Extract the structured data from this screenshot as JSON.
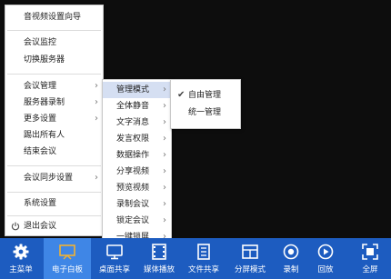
{
  "main_menu": {
    "items": [
      {
        "label": "音视频设置向导"
      },
      {
        "label": "会议监控"
      },
      {
        "label": "切换服务器"
      },
      {
        "label": "会议管理",
        "arrow": "›"
      },
      {
        "label": "服务器录制",
        "arrow": "›"
      },
      {
        "label": "更多设置",
        "arrow": "›"
      },
      {
        "label": "踢出所有人"
      },
      {
        "label": "结束会议"
      },
      {
        "label": "会议同步设置",
        "arrow": "›"
      },
      {
        "label": "系统设置"
      },
      {
        "label": "退出会议"
      }
    ]
  },
  "submenu_meeting": {
    "items": [
      {
        "label": "管理模式",
        "arrow": "›"
      },
      {
        "label": "全体静音",
        "arrow": "›"
      },
      {
        "label": "文字消息",
        "arrow": "›"
      },
      {
        "label": "发言权限",
        "arrow": "›"
      },
      {
        "label": "数据操作",
        "arrow": "›"
      },
      {
        "label": "分享视频",
        "arrow": "›"
      },
      {
        "label": "预览视频",
        "arrow": "›"
      },
      {
        "label": "录制会议",
        "arrow": "›"
      },
      {
        "label": "锁定会议",
        "arrow": "›"
      },
      {
        "label": "一键锁屏",
        "arrow": "›"
      }
    ]
  },
  "submenu_mode": {
    "items": [
      {
        "label": "自由管理",
        "check": "✔"
      },
      {
        "label": "统一管理"
      }
    ]
  },
  "taskbar": {
    "buttons": [
      {
        "label": "主菜单"
      },
      {
        "label": "电子白板"
      },
      {
        "label": "桌面共享"
      },
      {
        "label": "媒体播放"
      },
      {
        "label": "文件共享"
      },
      {
        "label": "分屏模式"
      },
      {
        "label": "录制"
      },
      {
        "label": "回放"
      },
      {
        "label": "全屏"
      }
    ]
  },
  "colors": {
    "taskbar_bg": "#1d5cc0",
    "taskbar_active": "#3f86e6",
    "menu_highlight": "#d5dff2",
    "icon_accent": "#f2b233"
  }
}
